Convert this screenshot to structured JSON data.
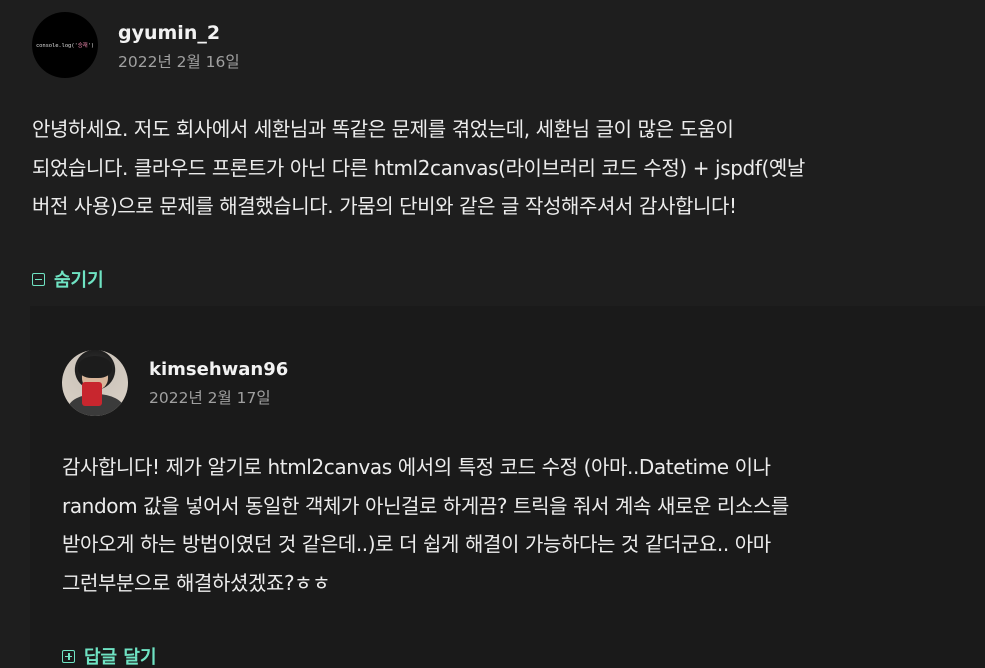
{
  "comment": {
    "avatar_text_prefix": "console.log('",
    "avatar_text_string": "승재",
    "avatar_text_suffix": "')",
    "username": "gyumin_2",
    "date": "2022년 2월 16일",
    "lines": [
      "안녕하세요. 저도 회사에서 세환님과 똑같은 문제를 겪었는데, 세환님 글이 많은 도움이",
      "되었습니다. 클라우드 프론트가 아닌 다른 html2canvas(라이브러리 코드 수정) + jspdf(옛날",
      "버전 사용)으로 문제를 해결했습니다. 가뭄의 단비와 같은 글 작성해주셔서 감사합니다!"
    ],
    "toggle_label": "숨기기"
  },
  "reply": {
    "username": "kimsehwan96",
    "date": "2022년 2월 17일",
    "lines": [
      "감사합니다! 제가 알기로 html2canvas 에서의 특정 코드 수정 (아마..Datetime 이나",
      "random 값을 넣어서 동일한 객체가 아닌걸로 하게끔? 트릭을 줘서 계속 새로운 리소스를",
      "받아오게 하는 방법이였던 것 같은데..)로 더 쉽게 해결이 가능하다는 것 같더군요.. 아마",
      "그런부분으로 해결하셨겠죠?ㅎㅎ"
    ],
    "reply_button_label": "답글 달기"
  },
  "colors": {
    "background": "#1e1e1e",
    "accent": "#6fe3c3",
    "text": "#ececec",
    "muted": "#a0a0a0"
  }
}
